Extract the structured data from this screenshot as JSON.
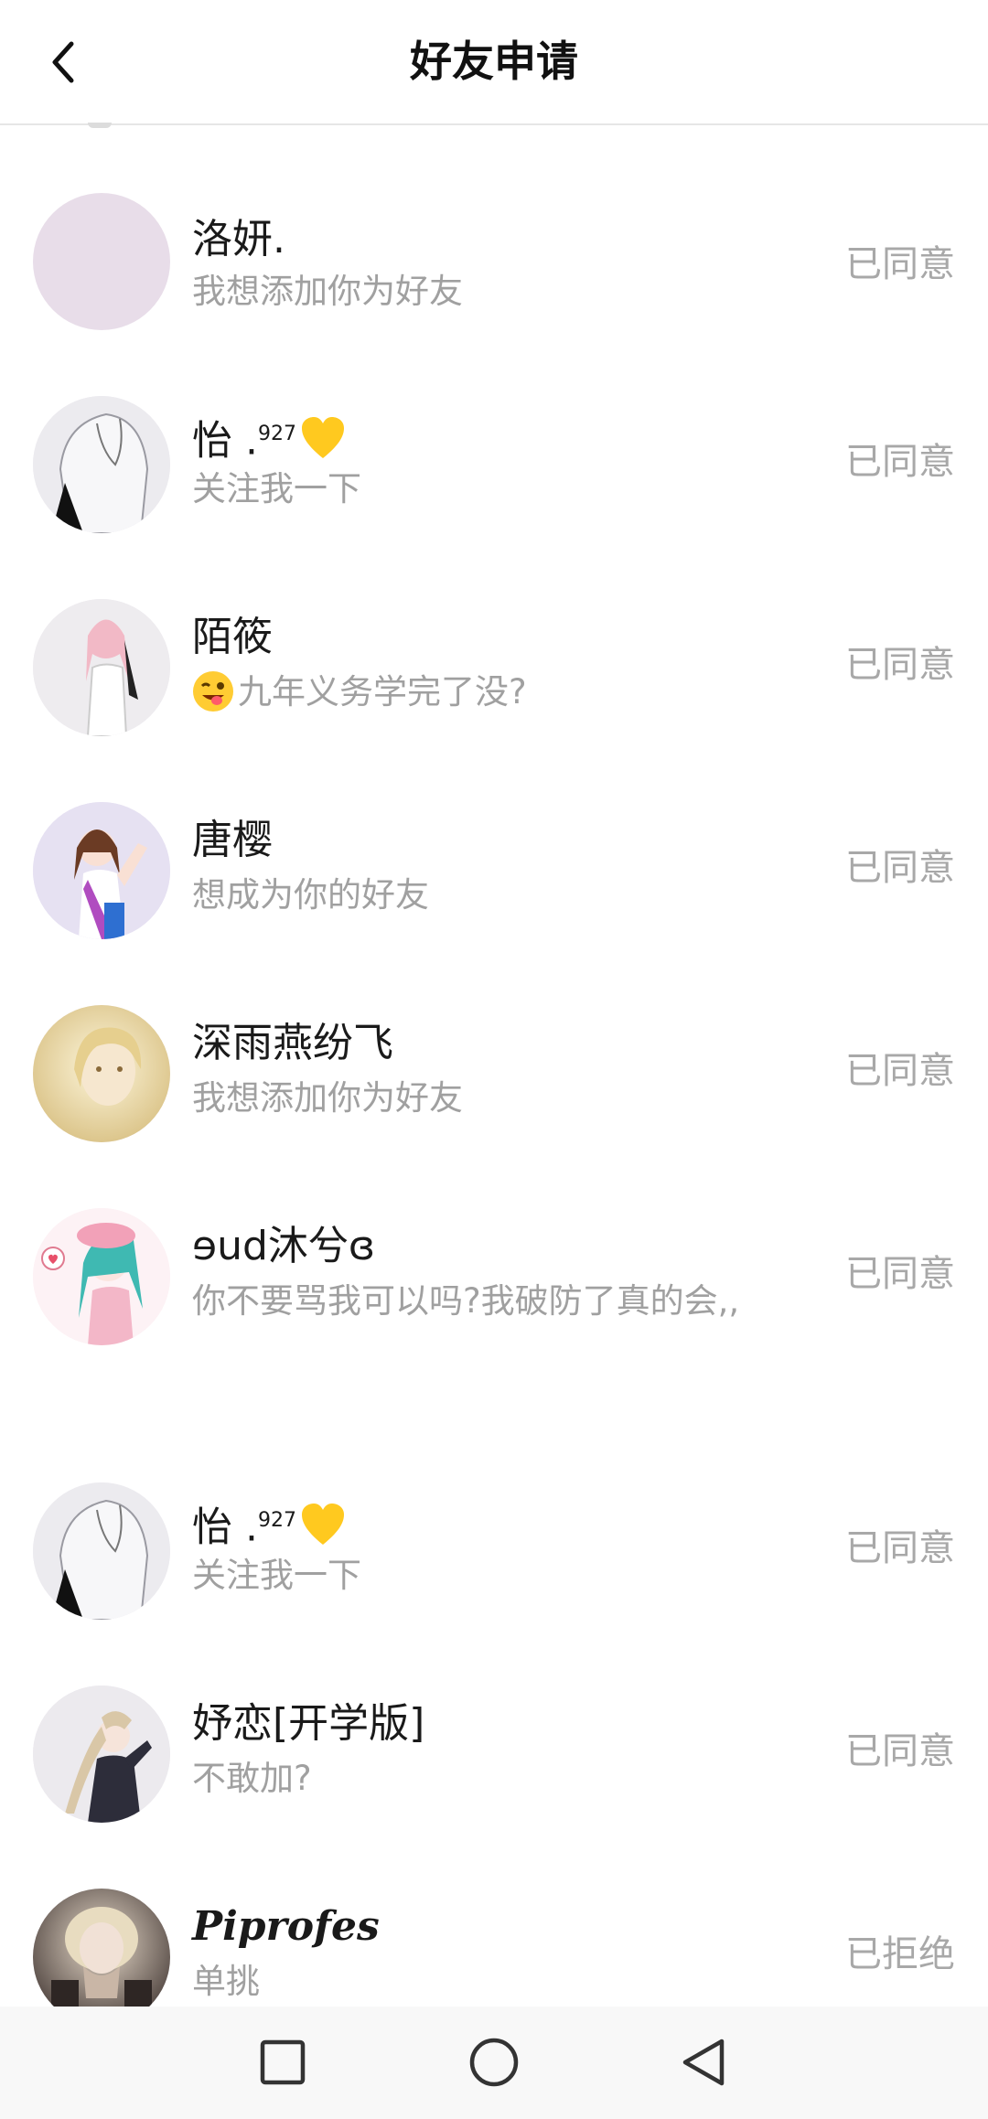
{
  "header": {
    "title": "好友申请",
    "back_icon": "chevron-left-icon"
  },
  "requests": [
    {
      "name": "洛妍.",
      "message": "我想添加你为好友",
      "status": "已同意",
      "avatar": "plain-lavender-avatar"
    },
    {
      "name": "怡 .",
      "name_sup": "927",
      "name_emoji": "yellow-heart-icon",
      "message": "关注我一下",
      "status": "已同意",
      "avatar": "white-hooded-figure-avatar"
    },
    {
      "name": "陌筱",
      "message_emoji": "winking-tongue-emoji",
      "message": "九年义务学完了没?",
      "status": "已同意",
      "avatar": "anime-girl-pink-hair-avatar"
    },
    {
      "name": "唐樱",
      "message": "想成为你的好友",
      "status": "已同意",
      "avatar": "anime-girl-waving-avatar"
    },
    {
      "name": "深雨燕纷飞",
      "message": "我想添加你为好友",
      "status": "已同意",
      "avatar": "golden-portrait-avatar"
    },
    {
      "name": "ɘud沐兮ɞ",
      "message": "你不要骂我可以吗?我破防了真的会,,",
      "status": "已同意",
      "avatar": "anime-girl-green-hair-avatar"
    },
    {
      "name": "怡 .",
      "name_sup": "927",
      "name_emoji": "yellow-heart-icon",
      "message": "关注我一下",
      "status": "已同意",
      "avatar": "white-hooded-figure-avatar"
    },
    {
      "name": "妤恋[开学版]",
      "message": "不敢加?",
      "status": "已同意",
      "avatar": "anime-girl-ponytail-avatar"
    },
    {
      "name": "Piprofes",
      "message": "单挑",
      "status": "已拒绝",
      "avatar": "blonde-photo-avatar"
    }
  ],
  "navbar": {
    "recents_icon": "square-recents-icon",
    "home_icon": "circle-home-icon",
    "back_icon": "triangle-back-icon"
  }
}
